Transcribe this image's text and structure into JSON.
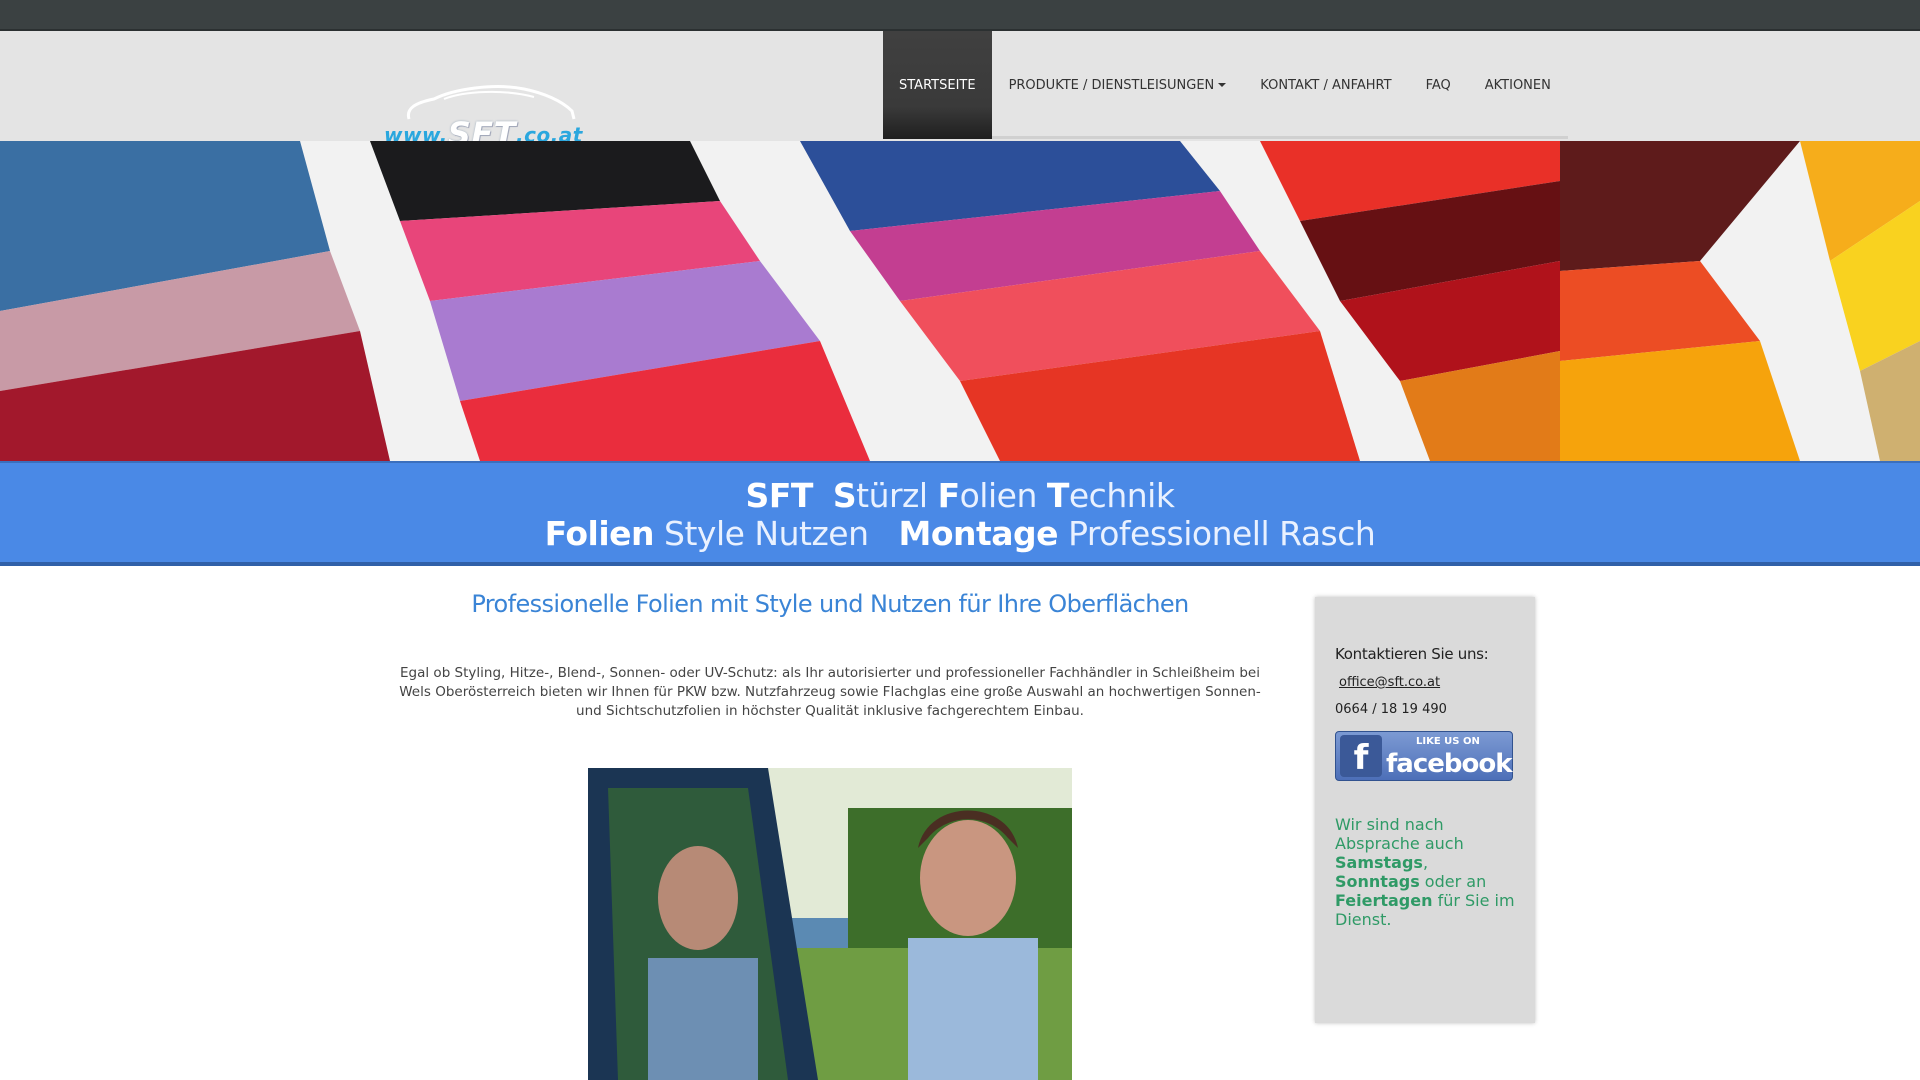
{
  "logo": {
    "prefix": "www.",
    "brand": "SFT",
    "suffix": ".co.at"
  },
  "nav": {
    "items": [
      {
        "label": "STARTSEITE",
        "active": true
      },
      {
        "label": "PRODUKTE / DIENSTLEISUNGEN",
        "dropdown": true
      },
      {
        "label": "KONTAKT / ANFAHRT"
      },
      {
        "label": "FAQ"
      },
      {
        "label": "AKTIONEN"
      }
    ]
  },
  "band": {
    "line1": {
      "a": "SFT",
      "b1": "S",
      "b2": "türzl",
      "c1": "F",
      "c2": "olien",
      "d1": "T",
      "d2": "echnik"
    },
    "line2": {
      "a": "Folien",
      "b": "Style Nutzen",
      "c": "Montage",
      "d": "Professionell Rasch"
    }
  },
  "main": {
    "heading": "Professionelle Folien mit Style und Nutzen für Ihre Oberflächen",
    "body": "Egal ob Styling, Hitze-, Blend-, Sonnen- oder UV-Schutz: als Ihr autorisierter und professioneller Fachhändler in Schleißheim bei Wels Oberösterreich bieten wir Ihnen für PKW bzw. Nutzfahrzeug sowie Flachglas eine große Auswahl an hochwertigen Sonnen- und Sichtschutzfolien in höchster Qualität inklusive fachgerechtem Einbau."
  },
  "sidebar": {
    "title": "Kontaktieren Sie uns:",
    "email": "office@sft.co.at",
    "phone": "0664 / 18 19 490",
    "facebook": {
      "like": "LIKE US ON",
      "word": "facebook"
    },
    "note": {
      "t1": "Wir sind nach Absprache auch ",
      "b1": "Samstags",
      "t2": ", ",
      "b2": "Sonntags",
      "t3": " oder an ",
      "b3": "Feiertagen",
      "t4": " für Sie im Dienst."
    }
  },
  "colors": {
    "band": "#4a89e6",
    "heading": "#3a84d6",
    "note": "#2f9a66",
    "topbar": "#3b4142"
  }
}
